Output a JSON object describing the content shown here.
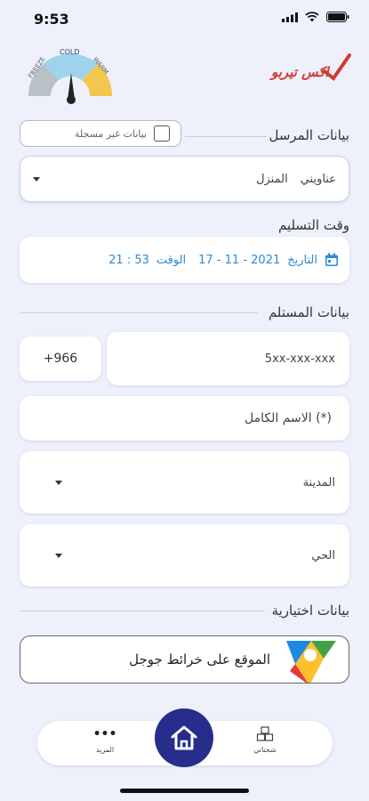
{
  "status": {
    "time": "9:53"
  },
  "logo": {
    "brand_text": "اكس تيربو"
  },
  "gauge": {
    "freeze": "FREEZE",
    "cold": "COLD",
    "warm": "WARM"
  },
  "sender": {
    "title": "بيانات المرسل",
    "unregistered_label": "بيانات غير مسجلة",
    "unregistered_checked": false,
    "address_label": "عناويني",
    "address_value": "المنزل"
  },
  "delivery": {
    "title": "وقت التسليم",
    "date_label": "التاريخ",
    "date_value": "17 - 11 - 2021",
    "time_label": "الوقت",
    "time_value": "21 : 53"
  },
  "recipient": {
    "title": "بيانات المستلم",
    "country_code": "+966",
    "phone_placeholder": "5xx-xxx-xxx",
    "fullname_placeholder": "الاسم الكامل (*)",
    "city_placeholder": "المدينة",
    "district_placeholder": "الحي"
  },
  "optional": {
    "title": "بيانات اختيارية",
    "maps_button_label": "الموقع على خرائط جوجل"
  },
  "nav": {
    "more_label": "المزيد",
    "shipments_label": "شحناتي"
  },
  "colors": {
    "accent": "#2b8ad6",
    "brand": "#262d8a"
  }
}
